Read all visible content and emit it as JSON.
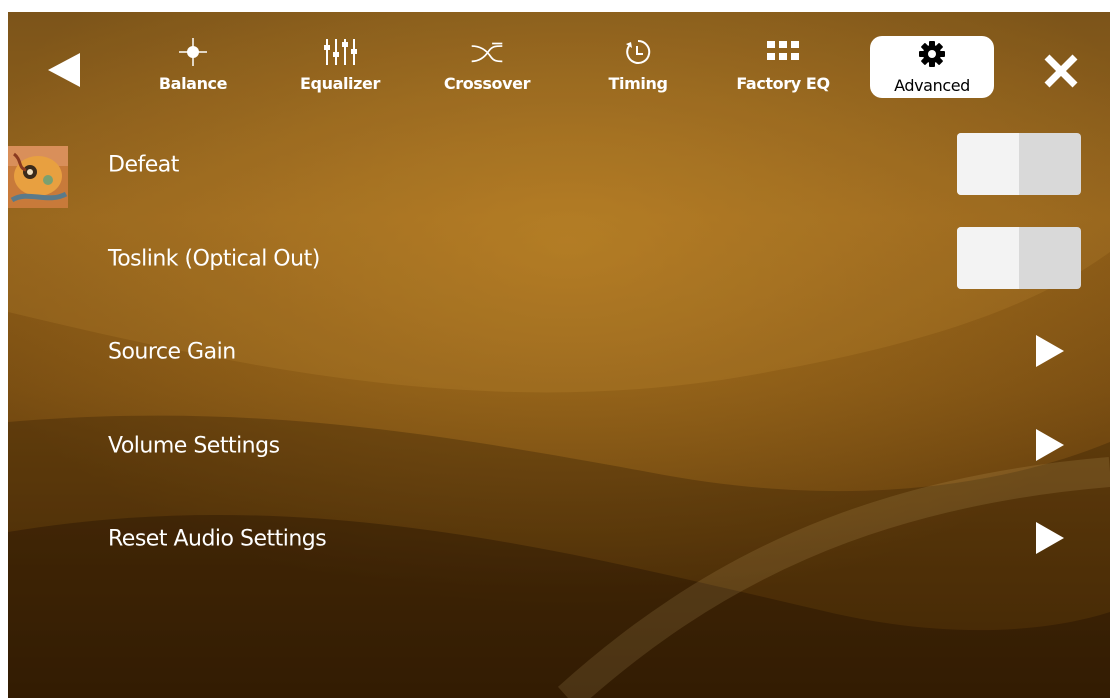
{
  "nav": {
    "back_icon": "back-triangle-icon",
    "close_icon": "close-x-icon",
    "tabs": [
      {
        "label": "Balance",
        "icon": "balance-target-icon",
        "active": false
      },
      {
        "label": "Equalizer",
        "icon": "equalizer-sliders-icon",
        "active": false
      },
      {
        "label": "Crossover",
        "icon": "crossover-curves-icon",
        "active": false
      },
      {
        "label": "Timing",
        "icon": "timing-clock-icon",
        "active": false
      },
      {
        "label": "Factory EQ",
        "icon": "factory-eq-grid-icon",
        "active": false
      },
      {
        "label": "Advanced",
        "icon": "gear-icon",
        "active": true
      }
    ]
  },
  "settings": [
    {
      "label": "Defeat",
      "control": "toggle",
      "on": false
    },
    {
      "label": "Toslink (Optical Out)",
      "control": "toggle",
      "on": false
    },
    {
      "label": "Source Gain",
      "control": "chevron"
    },
    {
      "label": "Volume Settings",
      "control": "chevron"
    },
    {
      "label": "Reset Audio Settings",
      "control": "chevron"
    }
  ],
  "colors": {
    "accent_text": "#ffffff",
    "active_tab_bg": "#ffffff",
    "background_top": "#6e4813",
    "background_bottom": "#4a2c06",
    "toggle_track": "#d9d9d9",
    "toggle_knob": "#f3f3f3"
  }
}
